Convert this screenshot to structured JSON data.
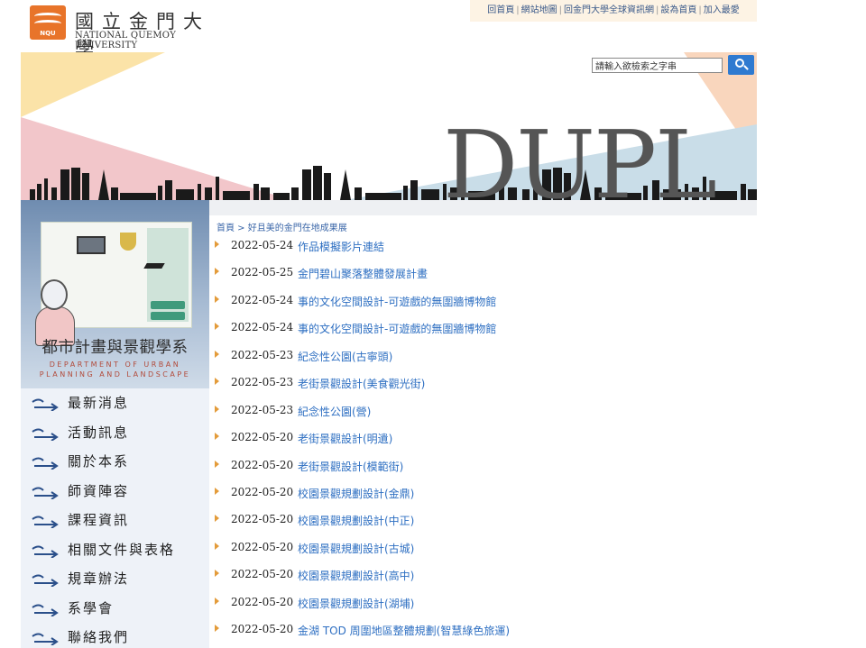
{
  "header": {
    "logo_badge": "NQU",
    "logo_cn": "國立金門大學",
    "logo_en": "NATIONAL QUEMOY UNIVERSITY",
    "links": [
      "回首頁",
      "網站地圖",
      "回金門大學全球資訊網",
      "設為首頁",
      "加入最愛"
    ]
  },
  "banner": {
    "title": "DUPL",
    "search_value": "請輸入欲檢索之字串"
  },
  "sidebar": {
    "title": "都市計畫與景觀學系",
    "subtitle_1": "DEPARTMENT OF URBAN",
    "subtitle_2": "PLANNING AND LANDSCAPE",
    "menu": [
      "最新消息",
      "活動訊息",
      "關於本系",
      "師資陣容",
      "課程資訊",
      "相關文件與表格",
      "規章辦法",
      "系學會",
      "聯絡我們"
    ]
  },
  "breadcrumb": {
    "home": "首頁",
    "separator": " > ",
    "current": "好且美的金門在地成果展"
  },
  "news": [
    {
      "date": "2022-05-24",
      "title": "作品模擬影片連結"
    },
    {
      "date": "2022-05-25",
      "title": "金門碧山聚落整體發展計畫"
    },
    {
      "date": "2022-05-24",
      "title": "事的文化空間設計-可遊戲的無圍牆博物館"
    },
    {
      "date": "2022-05-24",
      "title": "事的文化空間設計-可遊戲的無圍牆博物館"
    },
    {
      "date": "2022-05-23",
      "title": "紀念性公園(古寧頭)"
    },
    {
      "date": "2022-05-23",
      "title": "老街景觀設計(美食觀光街)"
    },
    {
      "date": "2022-05-23",
      "title": "紀念性公園(營)"
    },
    {
      "date": "2022-05-20",
      "title": "老街景觀設計(明遺)"
    },
    {
      "date": "2022-05-20",
      "title": "老街景觀設計(模範街)"
    },
    {
      "date": "2022-05-20",
      "title": "校園景觀規劃設計(金鼎)"
    },
    {
      "date": "2022-05-20",
      "title": "校園景觀規劃設計(中正)"
    },
    {
      "date": "2022-05-20",
      "title": "校園景觀規劃設計(古城)"
    },
    {
      "date": "2022-05-20",
      "title": "校園景觀規劃設計(高中)"
    },
    {
      "date": "2022-05-20",
      "title": "校園景觀規劃設計(湖埔)"
    },
    {
      "date": "2022-05-20",
      "title": "金湖 TOD 周圍地區整體規劃(智慧綠色旅運)"
    }
  ],
  "colors": {
    "link_blue": "#2e6fc2",
    "bullet_orange": "#e39b3a",
    "logo_orange": "#e8742a",
    "search_button": "#2f7ad0"
  }
}
